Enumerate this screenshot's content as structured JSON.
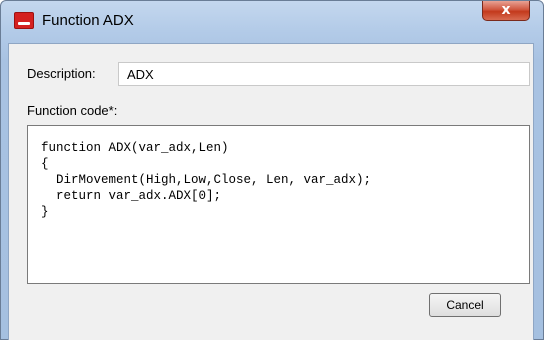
{
  "window": {
    "title": "Function ADX",
    "close_glyph": "x",
    "icon": "app-logo-icon"
  },
  "form": {
    "description_label": "Description:",
    "description_value": "ADX",
    "code_label": "Function code*:",
    "code_value": "function ADX(var_adx,Len)\n{\n  DirMovement(High,Low,Close, Len, var_adx);\n  return var_adx.ADX[0];\n}"
  },
  "buttons": {
    "cancel_label": "Cancel"
  }
}
